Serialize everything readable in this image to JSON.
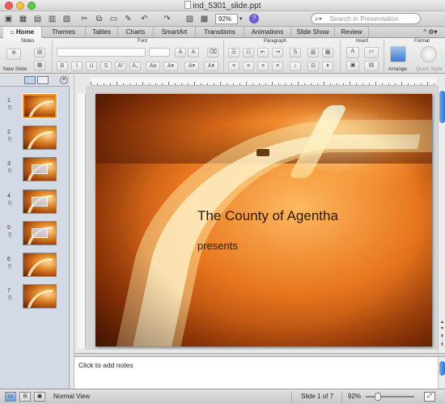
{
  "window": {
    "title": "ind_5301_slide.ppt"
  },
  "toolbar": {
    "zoom": "92%",
    "search_placeholder": "Search in Presentation"
  },
  "ribbon": {
    "tabs": [
      {
        "label": "Home",
        "active": true
      },
      {
        "label": "Themes"
      },
      {
        "label": "Tables"
      },
      {
        "label": "Charts"
      },
      {
        "label": "SmartArt"
      },
      {
        "label": "Transitions"
      },
      {
        "label": "Animations"
      },
      {
        "label": "Slide Show"
      },
      {
        "label": "Review"
      }
    ],
    "groups": {
      "slides": "Slides",
      "font": "Font",
      "paragraph": "Paragraph",
      "insert": "Insert",
      "format": "Format"
    },
    "new_slide": "New Slide",
    "arrange": "Arrange",
    "quick_styles": "Quick Style"
  },
  "slides_panel": {
    "thumbnails": [
      {
        "number": "1",
        "selected": true,
        "variant": "road"
      },
      {
        "number": "2",
        "variant": "road"
      },
      {
        "number": "3",
        "variant": "chart"
      },
      {
        "number": "4",
        "variant": "diagram"
      },
      {
        "number": "5",
        "variant": "table"
      },
      {
        "number": "6",
        "variant": "road"
      },
      {
        "number": "7",
        "variant": "road"
      }
    ]
  },
  "slide": {
    "title": "The County of Agentha",
    "subtitle": "presents"
  },
  "notes": {
    "text": "Click to add notes"
  },
  "status": {
    "view": "Normal View",
    "slide_position": "Slide 1 of 7",
    "zoom": "92%"
  },
  "icons": [
    "close-icon",
    "minimize-icon",
    "zoom-icon",
    "search-icon",
    "help-icon",
    "slide-sorter-icon",
    "notes-page-icon",
    "slideshow-icon",
    "fit-window-icon"
  ],
  "colors": {
    "accent_selected": "#f29a23",
    "scroll_thumb": "#2f73d2"
  }
}
